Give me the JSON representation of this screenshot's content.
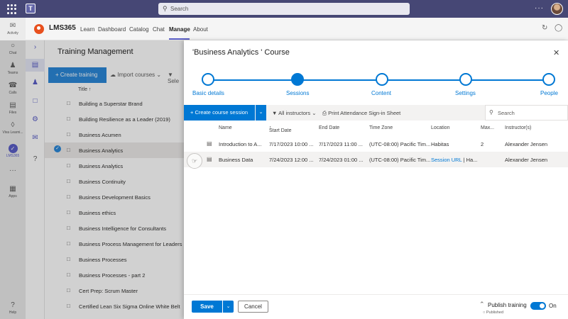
{
  "search": {
    "placeholder": "Search"
  },
  "rail": [
    {
      "label": "Activity",
      "icon": "bell-icon"
    },
    {
      "label": "Chat",
      "icon": "chat-icon"
    },
    {
      "label": "Teams",
      "icon": "teams-icon"
    },
    {
      "label": "Calls",
      "icon": "phone-icon"
    },
    {
      "label": "Files",
      "icon": "file-icon"
    },
    {
      "label": "Viva Learni...",
      "icon": "learning-icon"
    },
    {
      "label": "LMS365",
      "icon": "lms-icon"
    },
    {
      "label": "Apps",
      "icon": "apps-icon"
    },
    {
      "label": "Help",
      "icon": "help-icon"
    }
  ],
  "app": {
    "name": "LMS365",
    "tabs": [
      "Learn",
      "Dashboard",
      "Catalog",
      "Chat",
      "Manage",
      "About"
    ],
    "active_tab": "Manage"
  },
  "background": {
    "title": "Training Management",
    "create_label": "Create training",
    "import_label": "Import courses",
    "select_label": "Sele",
    "column_title": "Title",
    "rows": [
      "Building a Superstar Brand",
      "Building Resilience as a Leader (2019)",
      "Business Acumen",
      "Business Analytics",
      "Business Analytics",
      "Business Continuity",
      "Business Development Basics",
      "Business ethics",
      "Business Intelligence for Consultants",
      "Business Process Management for Leaders",
      "Business Processes",
      "Business Processes - part 2",
      "Cert Prep: Scrum Master",
      "Certified Lean Six Sigma Online White Belt"
    ]
  },
  "panel": {
    "title": "'Business Analytics ' Course",
    "steps": [
      "Basic details",
      "Sessions",
      "Content",
      "Settings",
      "People"
    ],
    "current_step": "Sessions",
    "toolbar": {
      "create_label": "Create course session",
      "filter_label": "All instructors",
      "print_label": "Print Attendance Sign-in Sheet",
      "search_placeholder": "Search"
    },
    "columns": [
      "Name",
      "Start Date",
      "End Date",
      "Time Zone",
      "Location",
      "Max...",
      "Instructor(s)"
    ],
    "sessions": [
      {
        "name": "Introduction to A...",
        "start": "7/17/2023 10:00 ...",
        "end": "7/17/2023 11:00 ...",
        "tz": "(UTC-08:00) Pacific Tim...",
        "location": "Habitas",
        "location_link": "",
        "location_rest": "",
        "max": "2",
        "instructor": "Alexander Jensen"
      },
      {
        "name": "Business Data",
        "start": "7/24/2023 12:00 ...",
        "end": "7/24/2023 01:00 ...",
        "tz": "(UTC-08:00) Pacific Tim...",
        "location": "",
        "location_link": "Session URL",
        "location_rest": " | Ha...",
        "max": "",
        "instructor": "Alexander Jensen"
      }
    ],
    "footer": {
      "save_label": "Save",
      "cancel_label": "Cancel",
      "publish_label": "Publish training",
      "publish_status": "Published",
      "toggle_label": "On",
      "toggle_on": true
    }
  }
}
